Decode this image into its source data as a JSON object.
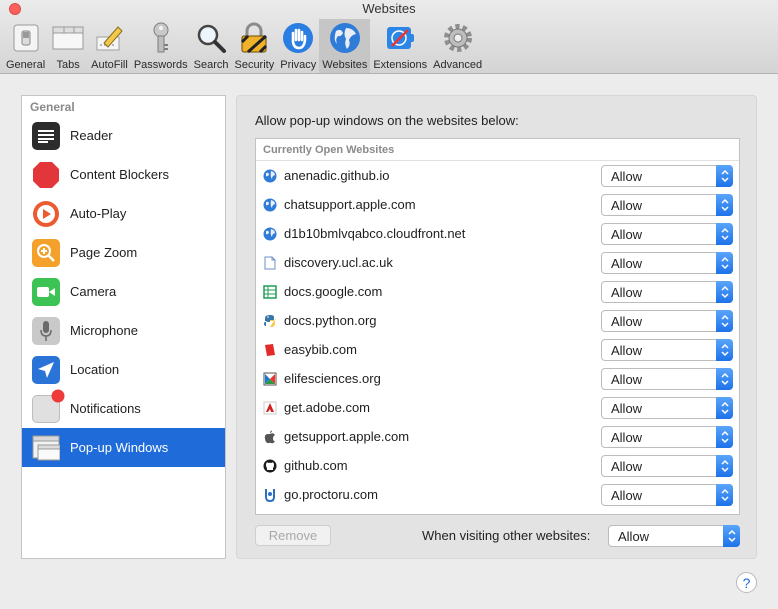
{
  "window": {
    "title": "Websites"
  },
  "toolbar": {
    "tabs": [
      {
        "label": "General",
        "icon": "general-switch-icon"
      },
      {
        "label": "Tabs",
        "icon": "tabs-icon"
      },
      {
        "label": "AutoFill",
        "icon": "autofill-pencil-icon"
      },
      {
        "label": "Passwords",
        "icon": "key-icon"
      },
      {
        "label": "Search",
        "icon": "magnifier-icon"
      },
      {
        "label": "Security",
        "icon": "padlock-icon"
      },
      {
        "label": "Privacy",
        "icon": "hand-icon"
      },
      {
        "label": "Websites",
        "icon": "globe-icon",
        "active": true
      },
      {
        "label": "Extensions",
        "icon": "extensions-icon"
      },
      {
        "label": "Advanced",
        "icon": "gear-icon"
      }
    ]
  },
  "sidebar": {
    "header": "General",
    "items": [
      {
        "label": "Reader",
        "icon": "reader-icon"
      },
      {
        "label": "Content Blockers",
        "icon": "stop-sign-icon"
      },
      {
        "label": "Auto-Play",
        "icon": "play-icon"
      },
      {
        "label": "Page Zoom",
        "icon": "zoom-icon"
      },
      {
        "label": "Camera",
        "icon": "camera-icon"
      },
      {
        "label": "Microphone",
        "icon": "microphone-icon"
      },
      {
        "label": "Location",
        "icon": "location-arrow-icon"
      },
      {
        "label": "Notifications",
        "icon": "notifications-icon"
      },
      {
        "label": "Pop-up Windows",
        "icon": "popup-windows-icon",
        "selected": true
      }
    ]
  },
  "main": {
    "heading": "Allow pop-up windows on the websites below:",
    "list_header": "Currently Open Websites",
    "sites": [
      {
        "name": "anenadic.github.io",
        "value": "Allow"
      },
      {
        "name": "chatsupport.apple.com",
        "value": "Allow"
      },
      {
        "name": "d1b10bmlvqabco.cloudfront.net",
        "value": "Allow"
      },
      {
        "name": "discovery.ucl.ac.uk",
        "value": "Allow"
      },
      {
        "name": "docs.google.com",
        "value": "Allow"
      },
      {
        "name": "docs.python.org",
        "value": "Allow"
      },
      {
        "name": "easybib.com",
        "value": "Allow"
      },
      {
        "name": "elifesciences.org",
        "value": "Allow"
      },
      {
        "name": "get.adobe.com",
        "value": "Allow"
      },
      {
        "name": "getsupport.apple.com",
        "value": "Allow"
      },
      {
        "name": "github.com",
        "value": "Allow"
      },
      {
        "name": "go.proctoru.com",
        "value": "Allow"
      }
    ],
    "remove_label": "Remove",
    "other_label": "When visiting other websites:",
    "other_value": "Allow"
  },
  "help": {
    "label": "?"
  },
  "colors": {
    "accent": "#1e6bd9",
    "selected_row": "#1e6bd9",
    "stepper": "#2f80ef"
  }
}
